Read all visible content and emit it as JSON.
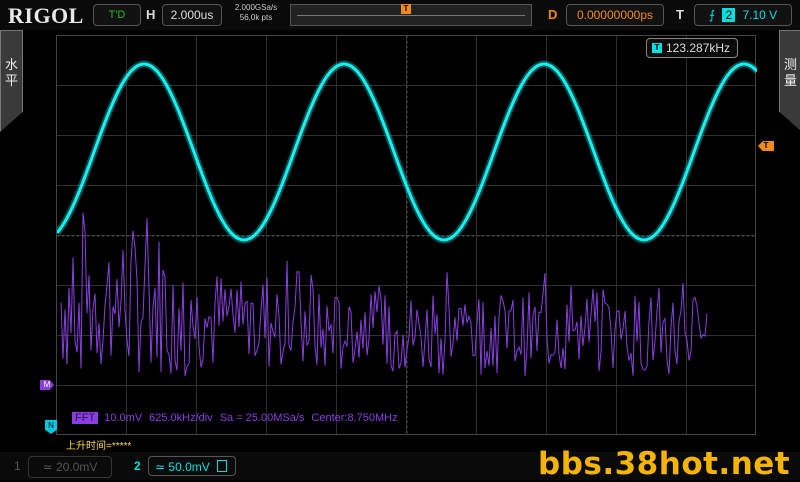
{
  "brand": {
    "logo": "RIGOL"
  },
  "status": {
    "run_state": "T'D"
  },
  "horizontal": {
    "label": "H",
    "timebase": "2.000us",
    "sample_rate": "2.000GSa/s",
    "memory_depth": "56.0k pts"
  },
  "delay": {
    "label": "D",
    "value": "0.00000000ps"
  },
  "trigger": {
    "label": "T",
    "source": "2",
    "level": "7.10 V",
    "marker": "T"
  },
  "side_menus": {
    "left": "水\n平",
    "right": "测\n量"
  },
  "measurement": {
    "tag": "T",
    "frequency": "123.287kHz"
  },
  "markers": {
    "math": "M",
    "ref": "N"
  },
  "fft": {
    "tag": "FFT",
    "scale": "10.0mV",
    "span": "625.0kHz/div",
    "sample_rate": "Sa = 25.00MSa/s",
    "center": "Center:8.750MHz"
  },
  "rise_time": "上升时间=*****",
  "channels": [
    {
      "number": "1",
      "coupling": "≃",
      "scale": "20.0mV",
      "color": "#555555"
    },
    {
      "number": "2",
      "coupling": "≃",
      "scale": "50.0mV",
      "color": "#00e0e0"
    }
  ],
  "watermark": "bbs.38hot.net",
  "colors": {
    "ch2": "#00e0e0",
    "math": "#8a3ee0",
    "trigger": "#f38b1c",
    "accent_text": "#ffd84a"
  }
}
